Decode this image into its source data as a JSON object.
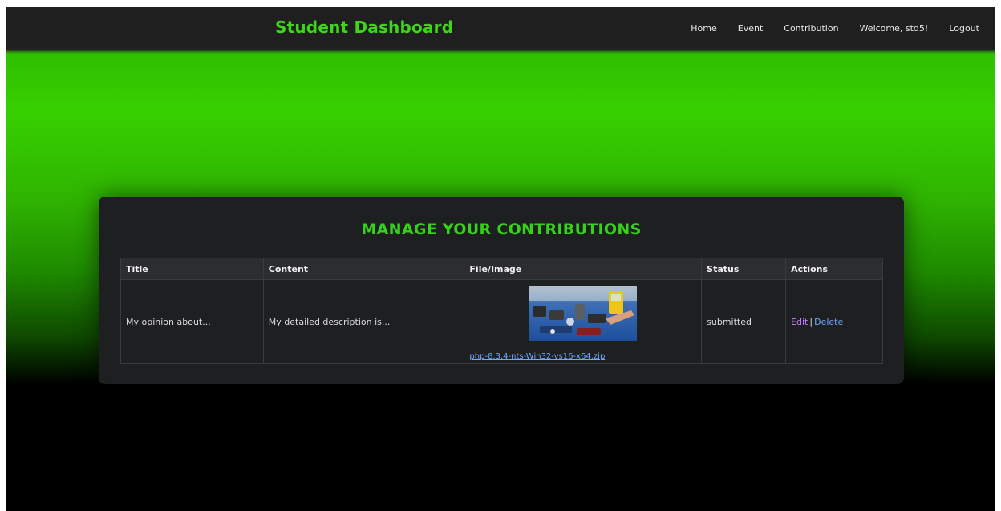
{
  "navbar": {
    "brand": "Student Dashboard",
    "links": {
      "home": "Home",
      "event": "Event",
      "contribution": "Contribution",
      "welcome": "Welcome, std5!",
      "logout": "Logout"
    }
  },
  "panel": {
    "title": "MANAGE YOUR CONTRIBUTIONS",
    "table": {
      "headers": {
        "title": "Title",
        "content": "Content",
        "file": "File/Image",
        "status": "Status",
        "actions": "Actions"
      },
      "rows": [
        {
          "title": "My opinion about...",
          "content": "My detailed description is...",
          "file_name": "php-8.3.4-nts-Win32-vs16-x64.zip",
          "status": "submitted",
          "edit": "Edit",
          "separator": "|",
          "delete": "Delete"
        }
      ]
    }
  },
  "colors": {
    "accent_green": "#36d21a",
    "link_blue": "#6fa8ff",
    "link_visited": "#c77bff",
    "navbar_bg": "#1f1f20",
    "panel_bg": "#1e1f21"
  }
}
